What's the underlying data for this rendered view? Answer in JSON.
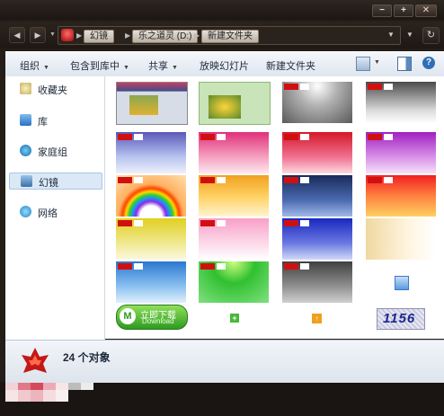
{
  "window": {
    "minimize": "−",
    "maximize": "+",
    "close": "✕"
  },
  "address": {
    "crumbs": [
      "幻镜",
      "乐之道灵 (D:)",
      "新建文件夹"
    ]
  },
  "toolbar": {
    "organize": "组织",
    "include_in_library": "包含到库中",
    "share": "共享",
    "slideshow": "放映幻灯片",
    "new_folder": "新建文件夹"
  },
  "sidebar": {
    "items": [
      {
        "label": "收藏夹",
        "icon": "star-icon"
      },
      {
        "label": "库",
        "icon": "library-icon"
      },
      {
        "label": "家庭组",
        "icon": "homegroup-icon"
      },
      {
        "label": "幻镜",
        "icon": "computer-icon"
      },
      {
        "label": "网络",
        "icon": "network-icon"
      }
    ]
  },
  "files": {
    "download_button": "立即下载",
    "download_sub": "Download",
    "captcha": "1156"
  },
  "status": {
    "count": "24 个对象"
  },
  "colors": {
    "accent": "#4d8fd0",
    "selection": "#dbe8f6"
  }
}
